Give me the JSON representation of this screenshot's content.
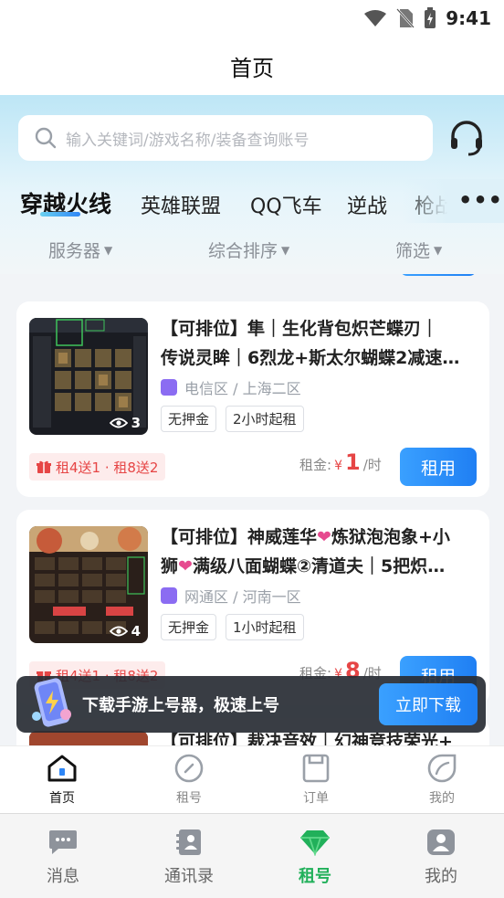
{
  "status_bar": {
    "time": "9:41"
  },
  "nav": {
    "title": "首页"
  },
  "search": {
    "placeholder": "输入关键词/游戏名称/装备查询账号"
  },
  "game_tabs": [
    "穿越火线",
    "英雄联盟",
    "QQ飞车",
    "逆战",
    "枪战"
  ],
  "filters": [
    "服务器",
    "综合排序",
    "筛选"
  ],
  "listings": [
    {
      "title_lines": [
        "【可排位】隼｜生化背包炽芒蝶刃｜",
        "传说灵眸｜6烈龙+斯太尔蝴蝶2减速…"
      ],
      "server": "电信区 / 上海二区",
      "views": "3",
      "tags": [
        "无押金",
        "2小时起租"
      ],
      "promo": "租4送1 · 租8送2",
      "price_label": "租金:",
      "currency": "¥",
      "price": "1",
      "unit": "/时",
      "button": "租用"
    },
    {
      "title_line1_a": "【可排位】神威莲华",
      "title_line1_b": "炼狱泡泡象+小",
      "title_line2_a": "狮",
      "title_line2_b": "满级八面蝴蝶②清道夫｜5把炽…",
      "heart": "❤",
      "server": "网通区 / 河南一区",
      "views": "4",
      "tags": [
        "无押金",
        "1小时起租"
      ],
      "promo": "租4送1 · 租8送2",
      "price_label": "租金:",
      "currency": "¥",
      "price": "8",
      "unit": "/时",
      "button": "租用"
    },
    {
      "title_partial": "【可排位】裁决音效｜幻神竞技荣光+"
    }
  ],
  "download_banner": {
    "text": "下载手游上号器，极速上号",
    "button": "立即下载"
  },
  "inner_tabbar": [
    {
      "label": "首页",
      "icon": "home-icon",
      "active": true
    },
    {
      "label": "租号",
      "icon": "compass-icon",
      "active": false
    },
    {
      "label": "订单",
      "icon": "order-icon",
      "active": false
    },
    {
      "label": "我的",
      "icon": "profile-leaf-icon",
      "active": false
    }
  ],
  "outer_tabbar": [
    {
      "label": "消息",
      "icon": "chat-icon",
      "active": false
    },
    {
      "label": "通讯录",
      "icon": "contacts-icon",
      "active": false
    },
    {
      "label": "租号",
      "icon": "diamond-icon",
      "active": true
    },
    {
      "label": "我的",
      "icon": "user-icon",
      "active": false
    }
  ],
  "colors": {
    "accent_blue": "#1f7ff3",
    "price_red": "#e64545",
    "active_green": "#21b05a"
  }
}
